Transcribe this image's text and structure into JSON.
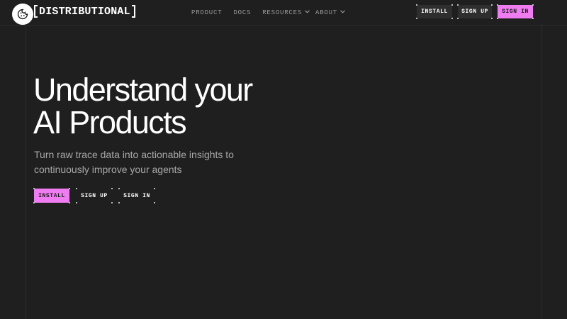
{
  "brand": {
    "name": "DISTRIBUTIONAL",
    "logo_icon": "cookie-icon"
  },
  "nav": {
    "product": "PRODUCT",
    "docs": "DOCS",
    "resources": "RESOURCES",
    "about": "ABOUT",
    "chevron_icon": "chevron-down-icon"
  },
  "header_actions": {
    "install": "INSTALL",
    "sign_up": "SIGN UP",
    "sign_in": "SIGN IN"
  },
  "hero": {
    "title_line1": "Understand your",
    "title_line2": "AI Products",
    "subtitle_line1": "Turn raw trace data into actionable insights to",
    "subtitle_line2": "continuously improve your agents",
    "cta_install": "INSTALL",
    "cta_sign_up": "SIGN UP",
    "cta_sign_in": "SIGN IN"
  },
  "colors": {
    "background": "#1f1f1f",
    "accent_pink": "#ef7cf0",
    "button_dark": "#2e2e2e",
    "muted_text": "#a8a8a8"
  }
}
